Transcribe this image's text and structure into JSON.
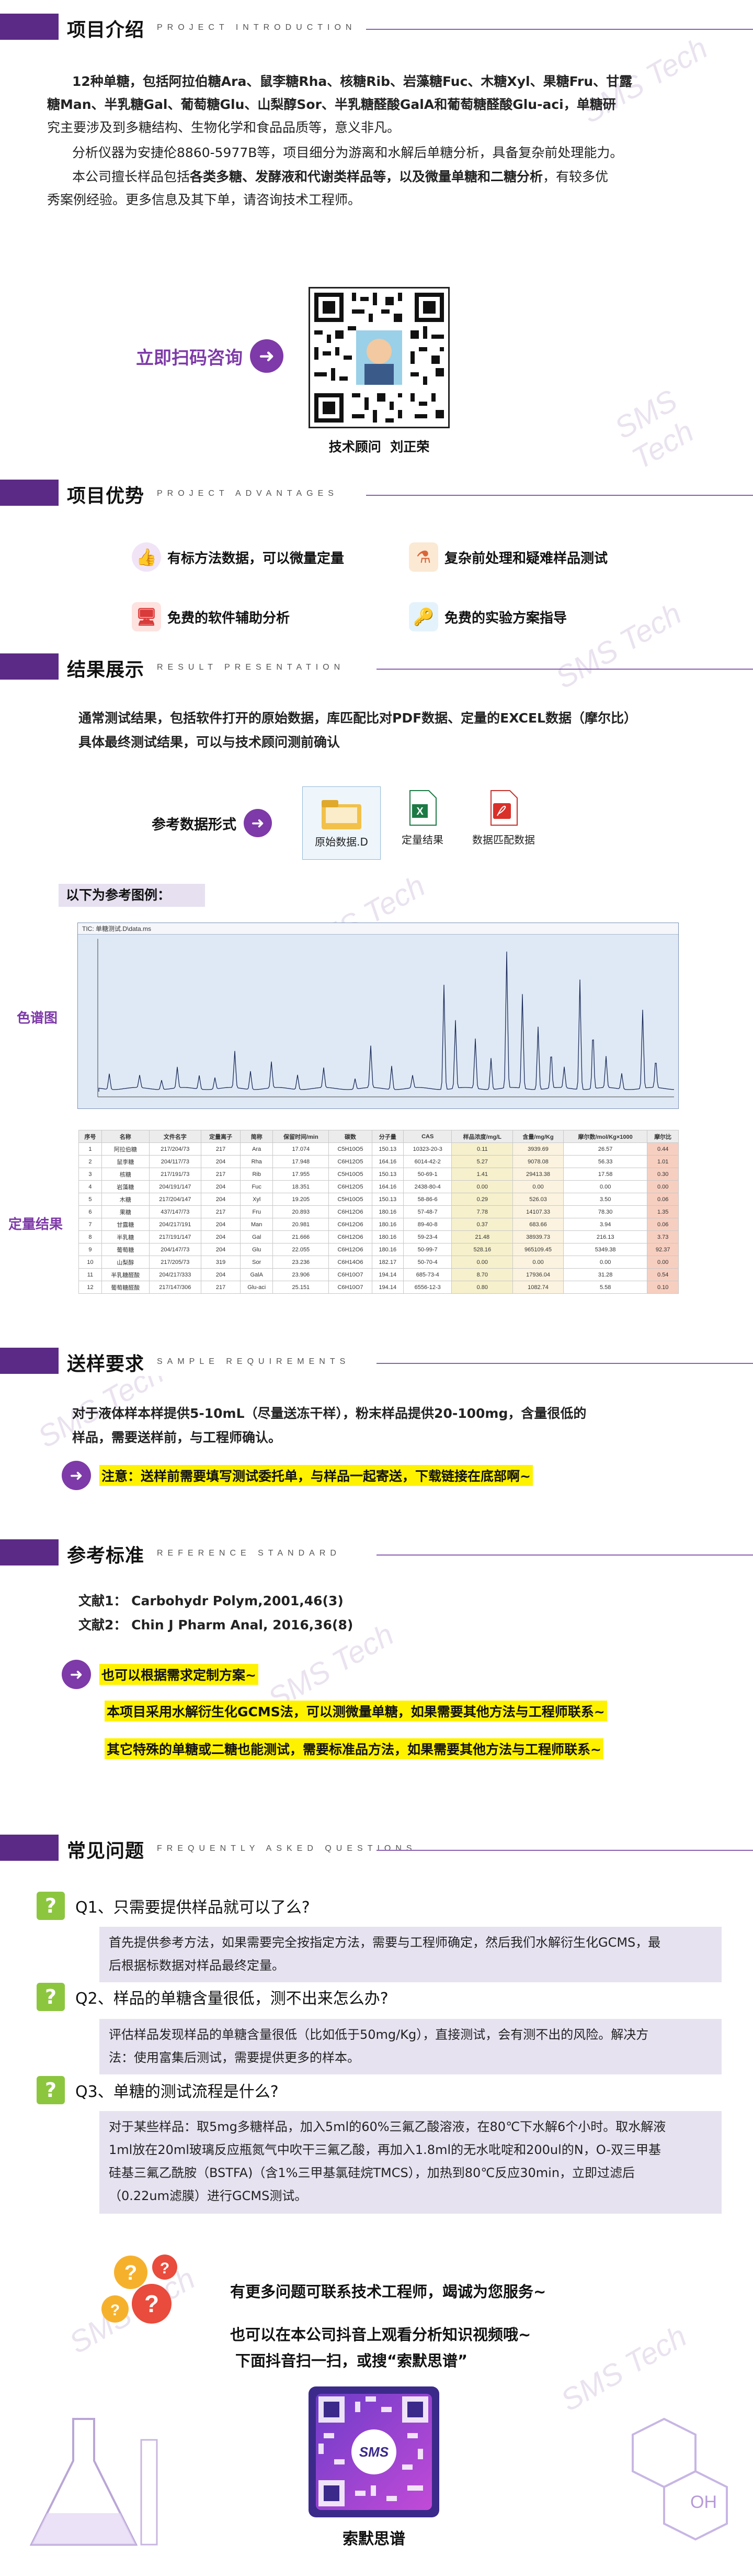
{
  "intro": {
    "title": "项目介绍",
    "title_en": "PROJECT INTRODUCTION",
    "p1_lines": [
      "12种单糖，包括阿拉伯糖Ara、鼠李糖Rha、核糖Rib、岩藻糖Fuc、木糖Xyl、果糖Fru、甘露",
      "糖Man、半乳糖Gal、葡萄糖Glu、山梨醇Sor、半乳糖醛酸GalA和葡萄糖醛酸Glu-aci，单糖研",
      "究主要涉及到多糖结构、生物化学和食品品质等，意义非凡。"
    ],
    "p2": "分析仪器为安捷伦8860-5977B等，项目细分为游离和水解后单糖分析，具备复杂前处理能力。",
    "p3_pre": "本公司擅长样品包括",
    "p3_bold1": "各类多糖、发酵液和代谢类样品等，以及微量单糖和二糖分析",
    "p3_post": "，有较多优",
    "p3_line2": "秀案例经验。更多信息及其下单，请咨询技术工程师。",
    "scan_label": "立即扫码咨询",
    "qr_caption": "技术顾问  刘正荣"
  },
  "advantages": {
    "title": "项目优势",
    "title_en": "PROJECT ADVANTAGES",
    "items": [
      {
        "label": "有标方法数据，可以微量定量",
        "icon": "thumbs-up-icon"
      },
      {
        "label": "复杂前处理和疑难样品测试",
        "icon": "lab-flask-icon"
      },
      {
        "label": "免费的软件辅助分析",
        "icon": "monitor-icon"
      },
      {
        "label": "免费的实验方案指导",
        "icon": "keys-icon"
      }
    ]
  },
  "results": {
    "title": "结果展示",
    "title_en": "RESULT PRESENTATION",
    "desc_line1": "通常测试结果，包括软件打开的原始数据，库匹配比对PDF数据、定量的EXCEL数据（摩尔比）",
    "desc_line2": "具体最终测试结果，可以与技术顾问测前确认",
    "ref_label": "参考数据形式",
    "files": [
      {
        "label": "原始数据.D",
        "icon": "folder-icon"
      },
      {
        "label": "定量结果",
        "icon": "excel-icon"
      },
      {
        "label": "数据匹配数据",
        "icon": "pdf-icon"
      }
    ],
    "example_banner": "以下为参考图例：",
    "chrom_label": "色谱图",
    "chrom_window_title": "TIC: 单糖测试.D\\data.ms",
    "quant_label": "定量结果",
    "table_headers": [
      "序号",
      "名称",
      "文件名字",
      "定量离子",
      "简称",
      "保留时间/min",
      "碳数",
      "分子量",
      "CAS",
      "样品浓度/mg/L",
      "含量/mg/Kg",
      "摩尔数/mol/Kg×1000",
      "摩尔比"
    ],
    "table_rows": [
      [
        "1",
        "阿拉伯糖",
        "217/204/73",
        "217",
        "Ara",
        "17.074",
        "C5H10O5",
        "150.13",
        "10323-20-3",
        "0.11",
        "3939.69",
        "26.57",
        "0.44"
      ],
      [
        "2",
        "鼠李糖",
        "204/117/73",
        "204",
        "Rha",
        "17.948",
        "C6H12O5",
        "164.16",
        "6014-42-2",
        "5.27",
        "9078.08",
        "56.33",
        "1.01"
      ],
      [
        "3",
        "核糖",
        "217/191/73",
        "217",
        "Rib",
        "17.955",
        "C5H10O5",
        "150.13",
        "50-69-1",
        "1.41",
        "29413.38",
        "17.58",
        "0.30"
      ],
      [
        "4",
        "岩藻糖",
        "204/191/147",
        "204",
        "Fuc",
        "18.351",
        "C6H12O5",
        "164.16",
        "2438-80-4",
        "0.00",
        "0.00",
        "0.00",
        "0.00"
      ],
      [
        "5",
        "木糖",
        "217/204/147",
        "204",
        "Xyl",
        "19.205",
        "C5H10O5",
        "150.13",
        "58-86-6",
        "0.29",
        "526.03",
        "3.50",
        "0.06"
      ],
      [
        "6",
        "果糖",
        "437/147/73",
        "217",
        "Fru",
        "20.893",
        "C6H12O6",
        "180.16",
        "57-48-7",
        "7.78",
        "14107.33",
        "78.30",
        "1.35"
      ],
      [
        "7",
        "甘露糖",
        "204/217/191",
        "204",
        "Man",
        "20.981",
        "C6H12O6",
        "180.16",
        "89-40-8",
        "0.37",
        "683.66",
        "3.94",
        "0.06"
      ],
      [
        "8",
        "半乳糖",
        "217/191/147",
        "204",
        "Gal",
        "21.666",
        "C6H12O6",
        "180.16",
        "59-23-4",
        "21.48",
        "38939.73",
        "216.13",
        "3.73"
      ],
      [
        "9",
        "葡萄糖",
        "204/147/73",
        "204",
        "Glu",
        "22.055",
        "C6H12O6",
        "180.16",
        "50-99-7",
        "528.16",
        "965109.45",
        "5349.38",
        "92.37"
      ],
      [
        "10",
        "山梨醇",
        "217/205/73",
        "319",
        "Sor",
        "23.236",
        "C6H14O6",
        "182.17",
        "50-70-4",
        "0.00",
        "0.00",
        "0.00",
        "0.00"
      ],
      [
        "11",
        "半乳糖醛酸",
        "204/217/333",
        "204",
        "GalA",
        "23.906",
        "C6H10O7",
        "194.14",
        "685-73-4",
        "8.70",
        "17936.04",
        "31.28",
        "0.54"
      ],
      [
        "12",
        "葡萄糖醛酸",
        "217/147/306",
        "217",
        "Glu-aci",
        "25.151",
        "C6H10O7",
        "194.14",
        "6556-12-3",
        "0.80",
        "1082.74",
        "5.58",
        "0.10"
      ]
    ]
  },
  "sample": {
    "title": "送样要求",
    "title_en": "SAMPLE REQUIREMENTS",
    "line1": "对于液体样本样提供5-10mL（尽量送冻干样），粉末样品提供20-100mg，含量很低的",
    "line2": "样品，需要送样前，与工程师确认。",
    "note": "注意：送样前需要填写测试委托单，与样品一起寄送，下载链接在底部啊~"
  },
  "reference": {
    "title": "参考标准",
    "title_en": "REFERENCE STANDARD",
    "ref1": "文献1： Carbohydr Polym,2001,46(3)",
    "ref2": "文献2： Chin J Pharm Anal, 2016,36(8)",
    "tip": "也可以根据需求定制方案~",
    "hl1": "本项目采用水解衍生化GCMS法，可以测微量单糖，如果需要其他方法与工程师联系~",
    "hl2": "其它特殊的单糖或二糖也能测试，需要标准品方法，如果需要其他方法与工程师联系~"
  },
  "faq": {
    "title": "常见问题",
    "title_en": "FREQUENTLY ASKED QUESTIONS",
    "items": [
      {
        "q": "Q1、只需要提供样品就可以了么?",
        "a": [
          "首先提供参考方法，如果需要完全按指定方法，需要与工程师确定，然后我们水解衍生化GCMS，最",
          "后根据标数据对样品最终定量。"
        ]
      },
      {
        "q": "Q2、样品的单糖含量很低，测不出来怎么办?",
        "a": [
          "评估样品发现样品的单糖含量很低（比如低于50mg/Kg），直接测试，会有测不出的风险。解决方",
          "法：使用富集后测试，需要提供更多的样本。"
        ]
      },
      {
        "q": "Q3、单糖的测试流程是什么?",
        "a": [
          "对于某些样品：取5mg多糖样品，加入5ml的60%三氟乙酸溶液，在80℃下水解6个小时。取水解液",
          "1ml放在20ml玻璃反应瓶氮气中吹干三氟乙酸，再加入1.8ml的无水吡啶和200ul的N，O-双三甲基",
          "硅基三氟乙酰胺（BSTFA)（含1%三甲基氯硅烷TMCS），加热到80℃反应30min，立即过滤后",
          "（0.22um滤膜）进行GCMS测试。"
        ]
      }
    ]
  },
  "footer": {
    "line1": "有更多问题可联系技术工程师，竭诚为您服务~",
    "line2": "也可以在本公司抖音上观看分析知识视频哦~",
    "line3": "下面抖音扫一扫，或搜“索默思谱”",
    "brand": "索默思谱",
    "logo_text": "SMS"
  },
  "watermark_text": "SMS Tech",
  "colors": {
    "brand_purple": "#5b2a86",
    "accent_purple": "#7e3aa8",
    "highlight": "#fff200",
    "faq_bg": "#e7e2f0",
    "q_green": "#8cc63f"
  }
}
